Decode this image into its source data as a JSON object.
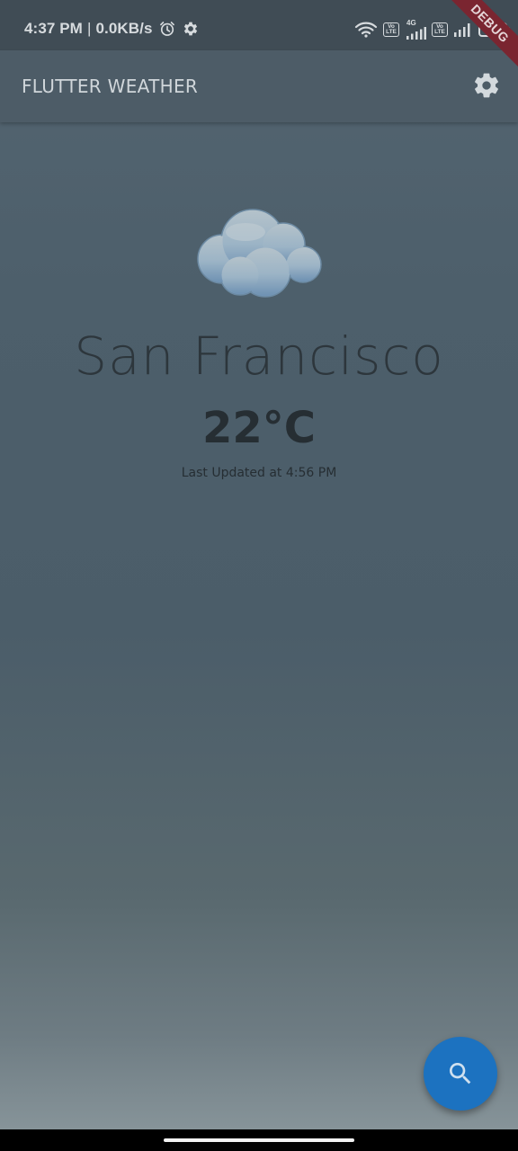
{
  "status_bar": {
    "time": "4:37 PM",
    "separator": "|",
    "network_speed": "0.0KB/s",
    "volte_1_top": "Vo",
    "volte_1_bottom": "LTE",
    "network_type": "4G",
    "volte_2_top": "Vo",
    "volte_2_bottom": "LTE",
    "battery_level": "60",
    "icons": [
      "alarm-icon",
      "gear-icon",
      "wifi-icon",
      "signal-icon",
      "battery-icon"
    ]
  },
  "debug_banner": "DEBUG",
  "app_bar": {
    "title": "FLUTTER WEATHER",
    "settings_icon": "gear-icon"
  },
  "weather": {
    "condition_icon": "cloud-icon",
    "city": "San Francisco",
    "temperature": "22°C",
    "last_updated": "Last Updated at 4:56 PM"
  },
  "fab": {
    "icon": "search-icon"
  },
  "colors": {
    "app_bar": "#4d5c67",
    "fab": "#1c72c0",
    "debug_ribbon": "#7a2530",
    "text_dark": "#262e33"
  }
}
